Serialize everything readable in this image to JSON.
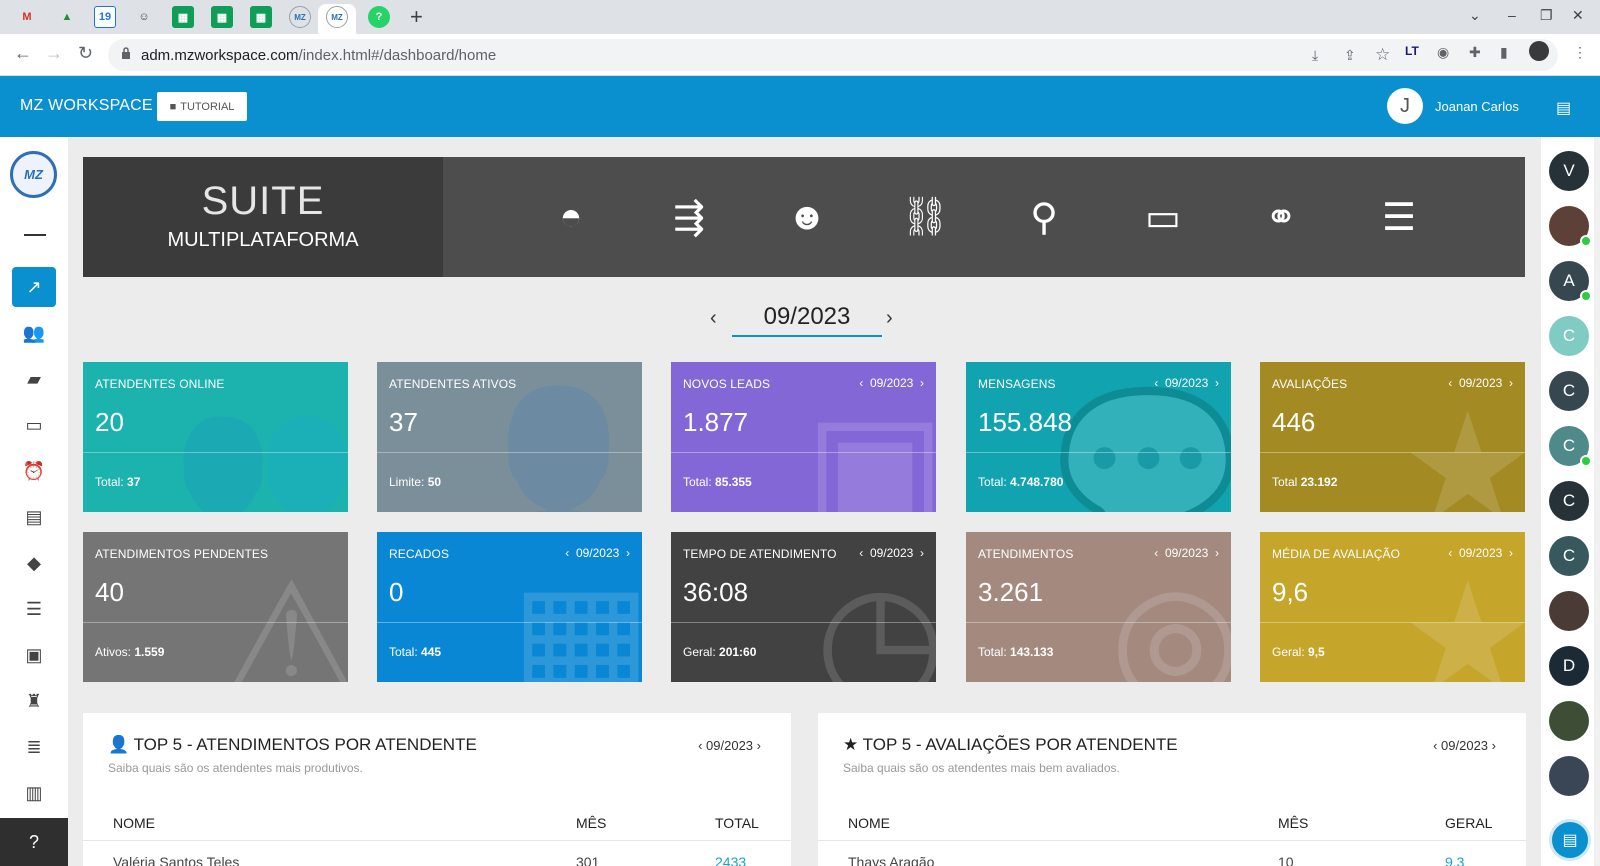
{
  "browser": {
    "url_domain": "adm.mzworkspace.com",
    "url_path": "/index.html#/dashboard/home"
  },
  "header": {
    "brand": "MZ WORKSPACE",
    "tutorial_label": "TUTORIAL",
    "user_initial": "J",
    "user_name": "Joanan Carlos"
  },
  "suite": {
    "title": "SUITE",
    "subtitle": "MULTIPLATAFORMA",
    "icons": [
      "headset-icon",
      "delivery-icon",
      "chatbot-icon",
      "link-icon",
      "location-icon",
      "payment-icon",
      "handshake-icon",
      "books-icon"
    ]
  },
  "month_selector": {
    "value": "09/2023"
  },
  "cards": [
    {
      "title": "ATENDENTES ONLINE",
      "value": "20",
      "foot_label": "Total:",
      "foot_value": "37",
      "period": "",
      "color": "#1cb3ae"
    },
    {
      "title": "ATENDENTES ATIVOS",
      "value": "37",
      "foot_label": "Limite:",
      "foot_value": "50",
      "period": "",
      "color": "#7b8f9b"
    },
    {
      "title": "NOVOS LEADS",
      "value": "1.877",
      "foot_label": "Total:",
      "foot_value": "85.355",
      "period": "09/2023",
      "color": "#8467d7"
    },
    {
      "title": "MENSAGENS",
      "value": "155.848",
      "foot_label": "Total:",
      "foot_value": "4.748.780",
      "period": "09/2023",
      "color": "#11a4b0"
    },
    {
      "title": "AVALIAÇÕES",
      "value": "446",
      "foot_label": "Total",
      "foot_value": "23.192",
      "period": "09/2023",
      "color": "#a38a22"
    },
    {
      "title": "ATENDIMENTOS PENDENTES",
      "value": "40",
      "foot_label": "Ativos:",
      "foot_value": "1.559",
      "period": "",
      "color": "#757575"
    },
    {
      "title": "RECADOS",
      "value": "0",
      "foot_label": "Total:",
      "foot_value": "445",
      "period": "09/2023",
      "color": "#0a87d4"
    },
    {
      "title": "TEMPO DE ATENDIMENTO",
      "value": "36:08",
      "foot_label": "Geral:",
      "foot_value": "201:60",
      "period": "09/2023",
      "color": "#424242"
    },
    {
      "title": "ATENDIMENTOS",
      "value": "3.261",
      "foot_label": "Total:",
      "foot_value": "143.133",
      "period": "09/2023",
      "color": "#a4897f"
    },
    {
      "title": "MÉDIA DE AVALIAÇÃO",
      "value": "9,6",
      "foot_label": "Geral:",
      "foot_value": "9,5",
      "period": "09/2023",
      "color": "#c5a52a"
    }
  ],
  "panels": [
    {
      "title": "TOP 5 - ATENDIMENTOS POR ATENDENTE",
      "subtitle": "Saiba quais são os atendentes mais produtivos.",
      "period": "09/2023",
      "columns": [
        "NOME",
        "MÊS",
        "TOTAL"
      ],
      "rows": [
        [
          "Valéria Santos Teles",
          "301",
          "2433"
        ]
      ]
    },
    {
      "title": "TOP 5 - AVALIAÇÕES POR ATENDENTE",
      "subtitle": "Saiba quais são os atendentes mais bem avaliados.",
      "period": "09/2023",
      "columns": [
        "NOME",
        "MÊS",
        "GERAL"
      ],
      "rows": [
        [
          "Thays Aragão",
          "10",
          "9,3"
        ]
      ]
    }
  ],
  "contacts": [
    {
      "initial": "V",
      "color": "#263238",
      "online": false
    },
    {
      "initial": "",
      "color": "#5d4037",
      "online": true
    },
    {
      "initial": "A",
      "color": "#37474f",
      "online": true
    },
    {
      "initial": "C",
      "color": "#80cbc4",
      "online": false
    },
    {
      "initial": "C",
      "color": "#37474f",
      "online": false
    },
    {
      "initial": "C",
      "color": "#4f8a8b",
      "online": true
    },
    {
      "initial": "C",
      "color": "#263238",
      "online": false
    },
    {
      "initial": "C",
      "color": "#37585c",
      "online": false
    },
    {
      "initial": "",
      "color": "#4a3b36",
      "online": false
    },
    {
      "initial": "D",
      "color": "#1c2a36",
      "online": false
    },
    {
      "initial": "",
      "color": "#3e4d36",
      "online": false
    },
    {
      "initial": "",
      "color": "#3a4656",
      "online": false
    }
  ]
}
